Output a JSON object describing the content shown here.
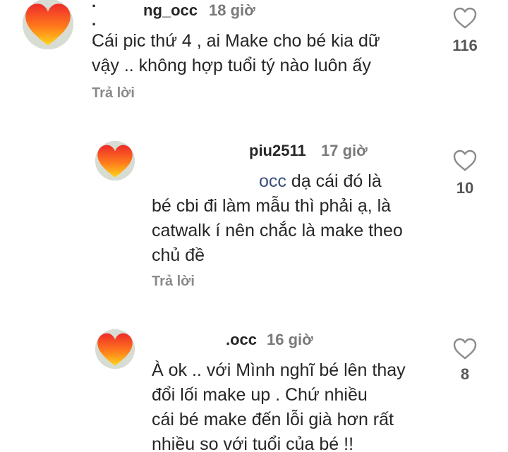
{
  "comments": [
    {
      "username": "ng_occ",
      "time": "18 giờ",
      "lines": [
        "Cái pic thứ 4 , ai Make cho bé kia dữ",
        "vậy .. không hợp tuổi tý nào luôn ấy"
      ],
      "reply_label": "Trả lời",
      "likes": "116",
      "mention": ""
    },
    {
      "username": "piu2511",
      "time": "17 giờ",
      "mention": "occ",
      "lines": [
        "dạ cái đó là",
        "bé cbi đi làm mẫu thì phải ạ, là",
        "catwalk í nên chắc là make theo",
        "chủ đề"
      ],
      "reply_label": "Trả lời",
      "likes": "10"
    },
    {
      "username": ".occ",
      "time": "16 giờ",
      "lines": [
        "À ok .. với Mình nghĩ bé lên thay",
        "đổi lối make up . Chứ nhiều",
        "cái bé make đến lỗi già hơn rất",
        "nhiều so với tuổi của bé !!"
      ],
      "reply_label": "",
      "likes": "8",
      "mention": ""
    }
  ],
  "icons": {
    "avatar": "heart-emoji-avatar",
    "like": "heart-outline-icon"
  },
  "colors": {
    "heart_top": "#f0392b",
    "heart_bottom": "#ffd21a"
  }
}
